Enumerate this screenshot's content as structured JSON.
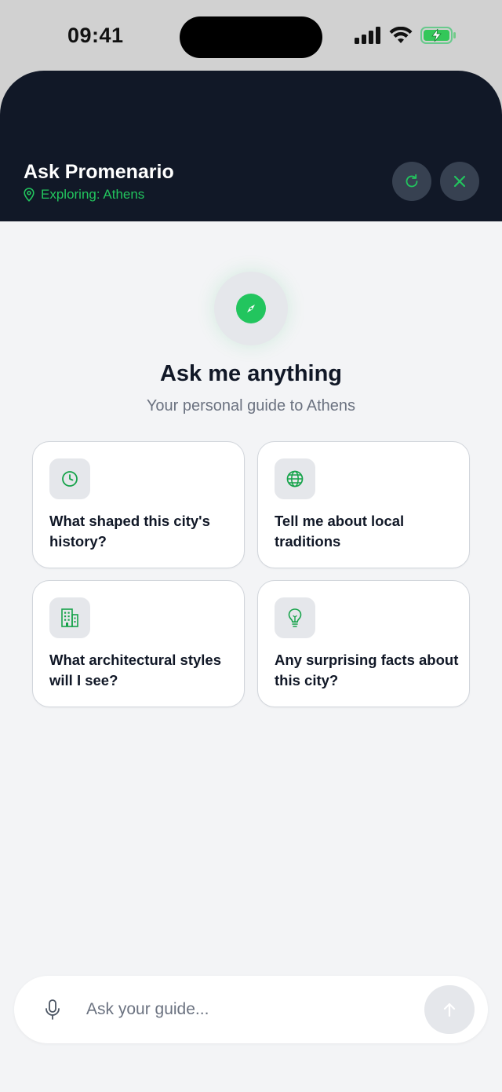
{
  "status_bar": {
    "time": "09:41"
  },
  "header": {
    "title": "Ask Promenario",
    "subtitle": "Exploring: Athens",
    "refresh_icon": "refresh-icon",
    "close_icon": "close-icon"
  },
  "hero": {
    "icon": "compass-icon",
    "title": "Ask me anything",
    "subtitle": "Your personal guide to Athens"
  },
  "suggestions": [
    {
      "icon": "clock-icon",
      "text": "What shaped this city's history?"
    },
    {
      "icon": "globe-icon",
      "text": "Tell me about local traditions"
    },
    {
      "icon": "building-icon",
      "text": "What architectural styles will I see?"
    },
    {
      "icon": "lightbulb-icon",
      "text": "Any surprising facts about this city?"
    }
  ],
  "input": {
    "placeholder": "Ask your guide...",
    "mic_icon": "microphone-icon",
    "send_icon": "send-arrow-icon"
  },
  "colors": {
    "accent": "#22c55e",
    "header_bg": "#111827",
    "page_bg": "#f3f4f6"
  }
}
